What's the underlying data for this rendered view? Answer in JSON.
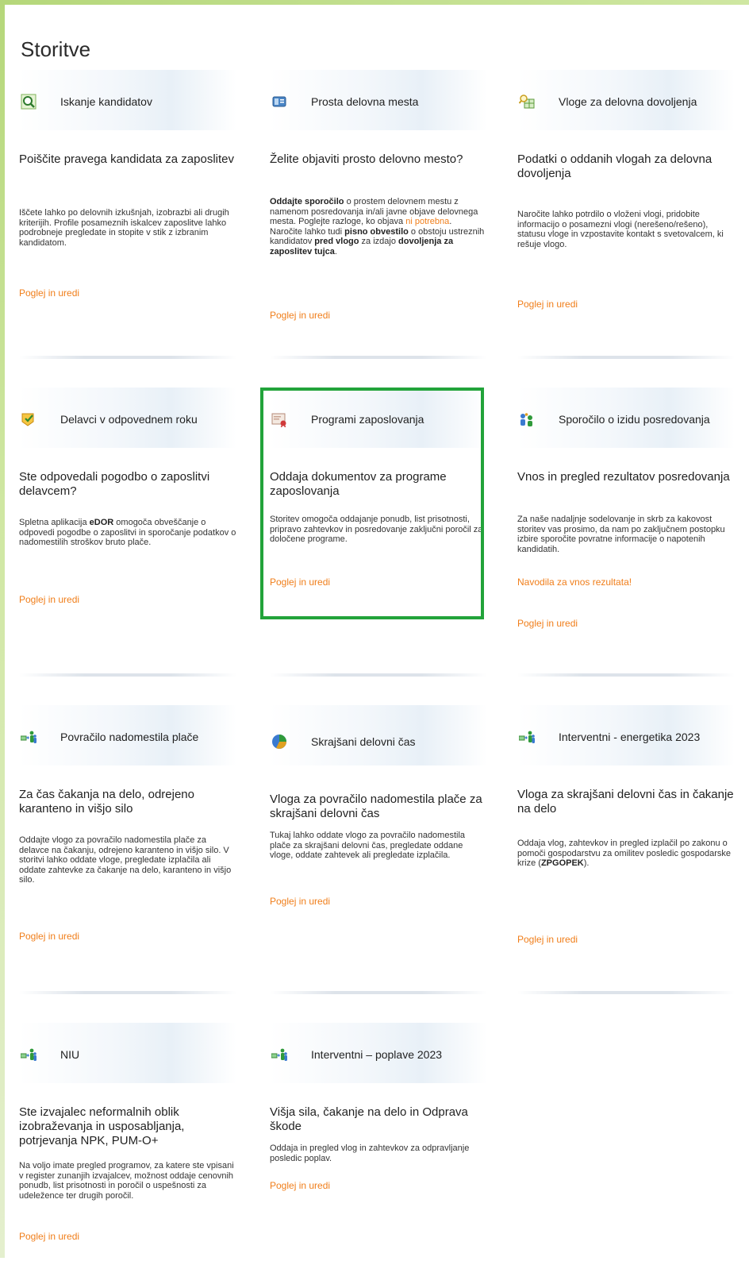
{
  "page": {
    "title": "Storitve"
  },
  "link_label": "Poglej in uredi",
  "cards": [
    {
      "id": "iskanje",
      "title": "Iskanje kandidatov",
      "icon": "magnifier-icon",
      "heading": "Poiščite pravega kandidata za zaposlitev",
      "desc": [
        "Iščete lahko po delovnih izkušnjah, izobrazbi ali drugih kriterijih. Profile posameznih iskalcev zaposlitve lahko podrobneje pregledate in stopite v stik z izbranim kandidatom."
      ]
    },
    {
      "id": "prosta",
      "title": "Prosta delovna mesta",
      "icon": "document-card-icon",
      "heading": "Želite objaviti prosto delovno mesto?",
      "desc_parts": {
        "b1": "Oddajte sporočilo",
        "t1": " o prostem delovnem mestu z namenom posredovanja in/ali javne objave delovnega mesta.  Poglejte razloge, ko objava ",
        "o1": "ni potrebna",
        "t2": ".",
        "t3": "Naročite lahko tudi ",
        "b2": "pisno obvestilo",
        "t4": " o obstoju ustreznih kandidatov ",
        "b3": "pred vlogo",
        "t5": " za izdajo ",
        "b4": "dovoljenja za zaposlitev tujca",
        "t6": "."
      }
    },
    {
      "id": "vloge",
      "title": "Vloge za delovna dovoljenja",
      "icon": "permit-search-icon",
      "heading": "Podatki o oddanih vlogah za delovna dovoljenja",
      "desc": [
        "Naročite lahko potrdilo o vloženi vlogi, pridobite informacijo o posamezni vlogi (nerešeno/rešeno), statusu vloge  in vzpostavite kontakt s svetovalcem, ki rešuje vlogo."
      ]
    },
    {
      "id": "delavci",
      "title": "Delavci v odpovednem roku",
      "icon": "notice-check-icon",
      "heading": "Ste odpovedali pogodbo o zaposlitvi delavcem?",
      "desc_parts": {
        "t1": "Spletna aplikacija ",
        "b1": "eDOR",
        "t2": " omogoča obveščanje o odpovedi pogodbe o zaposlitvi in sporočanje podatkov o nadomestilih stroškov bruto plače."
      }
    },
    {
      "id": "programi",
      "title": "Programi zaposlovanja",
      "icon": "certificate-icon",
      "heading": "Oddaja dokumentov za programe zaposlovanja",
      "desc": [
        "Storitev omogoča oddajanje ponudb, list prisotnosti, pripravo zahtevkov in posredovanje zaključni poročil za določene programe."
      ]
    },
    {
      "id": "sporocilo",
      "title": "Sporočilo o izidu posredovanja",
      "icon": "people-icon",
      "heading": "Vnos in pregled rezultatov posredovanja",
      "desc": [
        "Za naše nadaljnje sodelovanje in skrb za kakovost storitev vas prosimo, da nam po zaključnem postopku izbire sporočite povratne informacije o napotenih kandidatih."
      ],
      "extra_link": "Navodila za vnos rezultata!"
    },
    {
      "id": "povracilo",
      "title": "Povračilo nadomestila plače",
      "icon": "people-money-icon",
      "heading": "Za čas čakanja na delo, odrejeno karanteno in višjo silo",
      "desc": [
        "Oddajte vlogo za povračilo nadomestila plače za delavce na čakanju, odrejeno karanteno in višjo silo. V storitvi lahko oddate vloge, pregledate izplačila ali oddate zahtevke za čakanje na delo, karanteno in višjo silo."
      ]
    },
    {
      "id": "skrajsani",
      "title": "Skrajšani delovni čas",
      "icon": "pie-chart-icon",
      "heading": "Vloga za povračilo nadomestila plače za skrajšani delovni čas",
      "desc": [
        "Tukaj lahko oddate vlogo za povračilo nadomestila plače za skrajšani delovni čas, pregledate oddane vloge, oddate zahtevek ali pregledate izplačila."
      ]
    },
    {
      "id": "energetika",
      "title": "Interventni - energetika 2023",
      "icon": "people-money-icon",
      "heading": "Vloga za skrajšani delovni čas in čakanje na delo",
      "desc_parts": {
        "t1": "Oddaja vlog, zahtevkov in pregled izplačil po zakonu o pomoči gospodarstvu za omilitev posledic gospodarske krize (",
        "b1": "ZPGOPEK",
        "t2": ")."
      }
    },
    {
      "id": "niu",
      "title": "NIU",
      "icon": "people-money-icon",
      "heading": "Ste izvajalec neformalnih oblik izobraževanja in usposabljanja, potrjevanja NPK, PUM-O+",
      "desc": [
        "Na voljo imate pregled programov, za katere ste vpisani v register zunanjih izvajalcev, možnost oddaje cenovnih ponudb, list prisotnosti in poročil o uspešnosti za udeležence ter drugih poročil."
      ]
    },
    {
      "id": "poplave",
      "title": "Interventni – poplave 2023",
      "icon": "people-money-icon",
      "heading": "Višja sila, čakanje na delo in Odprava škode",
      "desc": [
        "Oddaja in pregled vlog in zahtevkov za odpravljanje posledic poplav."
      ]
    }
  ]
}
